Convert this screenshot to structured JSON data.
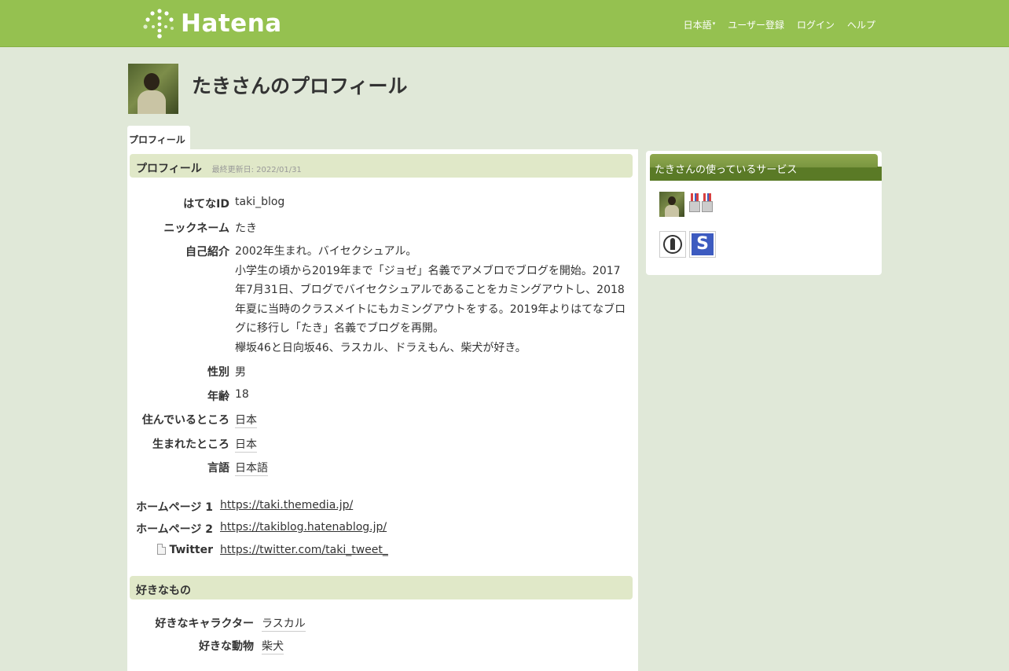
{
  "header": {
    "logo_text": "Hatena",
    "nav": {
      "language": "日本語",
      "register": "ユーザー登録",
      "login": "ログイン",
      "help": "ヘルプ"
    }
  },
  "page_title": "たきさんのプロフィール",
  "tab_label": "プロフィール",
  "profile": {
    "section_title": "プロフィール",
    "updated": "最終更新日: 2022/01/31",
    "fields": {
      "hatena_id_label": "はてなID",
      "hatena_id": "taki_blog",
      "nickname_label": "ニックネーム",
      "nickname": "たき",
      "bio_label": "自己紹介",
      "bio_lines": [
        "2002年生まれ。バイセクシュアル。",
        "小学生の頃から2019年まで「ジョゼ」名義でアメブロでブログを開始。2017",
        "年7月31日、ブログでバイセクシュアルであることをカミングアウトし、2018",
        "年夏に当時のクラスメイトにもカミングアウトをする。2019年よりはてなブロ",
        "グに移行し「たき」名義でブログを再開。",
        "欅坂46と日向坂46、ラスカル、ドラえもん、柴犬が好き。"
      ],
      "gender_label": "性別",
      "gender": "男",
      "age_label": "年齢",
      "age": "18",
      "location_label": "住んでいるところ",
      "location": "日本",
      "birthplace_label": "生まれたところ",
      "birthplace": "日本",
      "language_label": "言語",
      "language": "日本語"
    },
    "links": {
      "homepage1_label": "ホームページ 1",
      "homepage1": "https://taki.themedia.jp/",
      "homepage2_label": "ホームページ 2",
      "homepage2": "https://takiblog.hatenablog.jp/",
      "twitter_label": "Twitter",
      "twitter": "https://twitter.com/taki_tweet_"
    }
  },
  "favorites": {
    "section_title": "好きなもの",
    "character_label": "好きなキャラクター",
    "character": "ラスカル",
    "animal_label": "好きな動物",
    "animal": "柴犬"
  },
  "sidebar": {
    "services_title": "たきさんの使っているサービス",
    "services": [
      "avatar-icon",
      "medal-icon",
      "pen-icon",
      "s-icon"
    ]
  },
  "colors": {
    "header_bg": "#95c150",
    "page_bg": "#e0e8d8",
    "section_bg": "#e0e8c8",
    "sidebar_head": "#5a7a26"
  }
}
